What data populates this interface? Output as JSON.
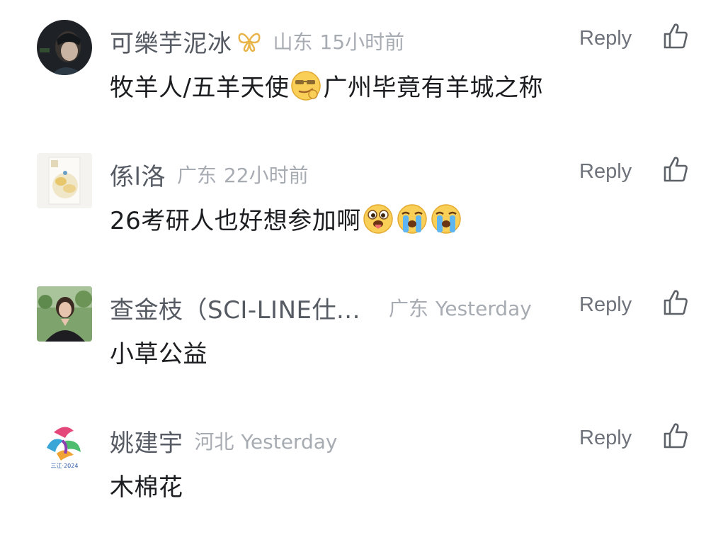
{
  "comments": [
    {
      "username": "可樂芋泥冰",
      "badge_icon": "butterfly-icon",
      "location": "山东",
      "time": "15小时前",
      "reply_label": "Reply",
      "content_before": "牧羊人/五羊天使",
      "emoji": [
        "smirk-sunglasses-emoji"
      ],
      "content_after": "广州毕竟有羊城之称",
      "avatar_style": "photo-dark"
    },
    {
      "username": "係l洛",
      "location": "广东",
      "time": "22小时前",
      "reply_label": "Reply",
      "content_before": "26考研人也好想参加啊",
      "emoji": [
        "tongue-out-emoji",
        "crying-emoji",
        "crying-emoji"
      ],
      "content_after": "",
      "avatar_style": "food-photo"
    },
    {
      "username": "查金枝（SCI-LINE仕...",
      "location": "广东",
      "time": "Yesterday",
      "reply_label": "Reply",
      "content_before": "小草公益",
      "emoji": [],
      "content_after": "",
      "avatar_style": "portrait-photo"
    },
    {
      "username": "姚建宇",
      "location": "河北",
      "time": "Yesterday",
      "reply_label": "Reply",
      "content_before": "木棉花",
      "emoji": [],
      "content_after": "",
      "avatar_style": "logo",
      "avatar_logo_text": "三江·2024"
    }
  ],
  "colors": {
    "username": "#555a63",
    "meta": "#a7abb2",
    "content": "#1c1d20",
    "reply": "#6e727a"
  }
}
